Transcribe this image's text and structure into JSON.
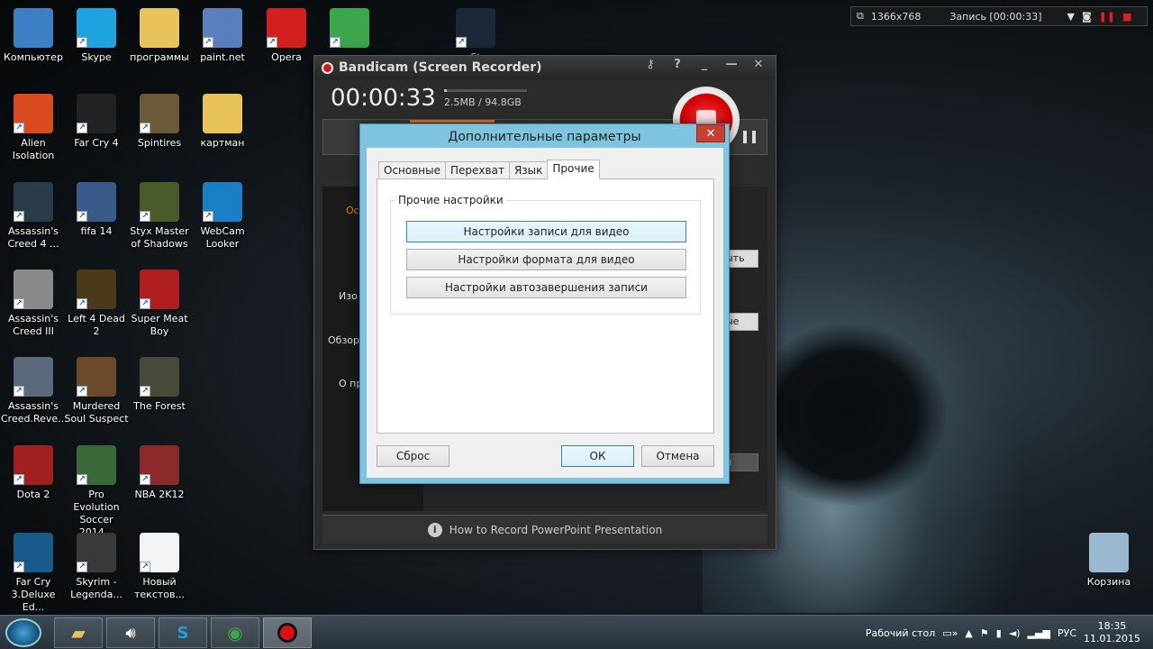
{
  "desktop": {
    "icons": [
      {
        "label": "Компьютер",
        "color": "#3b7fc4"
      },
      {
        "label": "Skype",
        "color": "#1fa2e0"
      },
      {
        "label": "программы",
        "color": "#e8c35a"
      },
      {
        "label": "paint.net",
        "color": "#5a7fbf"
      },
      {
        "label": "Opera",
        "color": "#d41f1f"
      },
      {
        "label": "",
        "color": "#3ca64a"
      },
      {
        "label": "St",
        "color": "#1b2838"
      },
      {
        "label": "Alien Isolation",
        "color": "#d94a1f"
      },
      {
        "label": "Far Cry 4",
        "color": "#222"
      },
      {
        "label": "Spintires",
        "color": "#6b5a3a"
      },
      {
        "label": "картман",
        "color": "#e8c35a"
      },
      {
        "label": "Assassin's Creed 4 ...",
        "color": "#2a3b4a"
      },
      {
        "label": "fifa 14",
        "color": "#3a5a8a"
      },
      {
        "label": "Styx Master of Shadows",
        "color": "#4a5a2a"
      },
      {
        "label": "WebCam Looker",
        "color": "#1a7fc4"
      },
      {
        "label": "Assassin's Creed III",
        "color": "#8a8a8a"
      },
      {
        "label": "Left 4 Dead 2",
        "color": "#4a3a1a"
      },
      {
        "label": "Super Meat Boy",
        "color": "#b01f1f"
      },
      {
        "label": "Assassin's Creed.Reve...",
        "color": "#5a6a7a"
      },
      {
        "label": "Murdered Soul Suspect",
        "color": "#6a4a2a"
      },
      {
        "label": "The Forest",
        "color": "#4a4a3a"
      },
      {
        "label": "Dota 2",
        "color": "#a01f1f"
      },
      {
        "label": "Pro Evolution Soccer 2014...",
        "color": "#3a6a3a"
      },
      {
        "label": "NBA 2K12",
        "color": "#8a2a2a"
      },
      {
        "label": "Far Cry 3.Deluxe Ed...",
        "color": "#1a5a8a"
      },
      {
        "label": "Skyrim - Legenda...",
        "color": "#3a3a3a"
      },
      {
        "label": "Новый текстов...",
        "color": "#f4f4f4"
      },
      {
        "label": "Корзина",
        "color": "#9ab8d0"
      }
    ]
  },
  "recorder_bar": {
    "resolution": "1366x768",
    "status": "Запись [00:00:33]"
  },
  "bandicam": {
    "title": "Bandicam (Screen Recorder)",
    "timer": "00:00:33",
    "size": "2.5MB / 94.8GB",
    "size_fraction": 0.03,
    "side_labels": [
      "Ос",
      "Изо",
      "Обзор",
      "О пр"
    ],
    "right_btns": [
      "ыть",
      "ые",
      "и"
    ],
    "bottom_tip": "How to Record PowerPoint Presentation"
  },
  "dialog": {
    "title": "Дополнительные параметры",
    "close_label": "✕",
    "tabs": [
      "Основные",
      "Перехват",
      "Язык",
      "Прочие"
    ],
    "active_tab": "Прочие",
    "group_label": "Прочие настройки",
    "buttons": [
      "Настройки записи для видео",
      "Настройки формата для видео",
      "Настройки автозавершения записи"
    ],
    "reset_label": "Сброс",
    "ok_label": "ОК",
    "cancel_label": "Отмена"
  },
  "taskbar": {
    "desktop_label": "Рабочий стол",
    "lang": "РУС",
    "time": "18:35",
    "date": "11.01.2015"
  }
}
